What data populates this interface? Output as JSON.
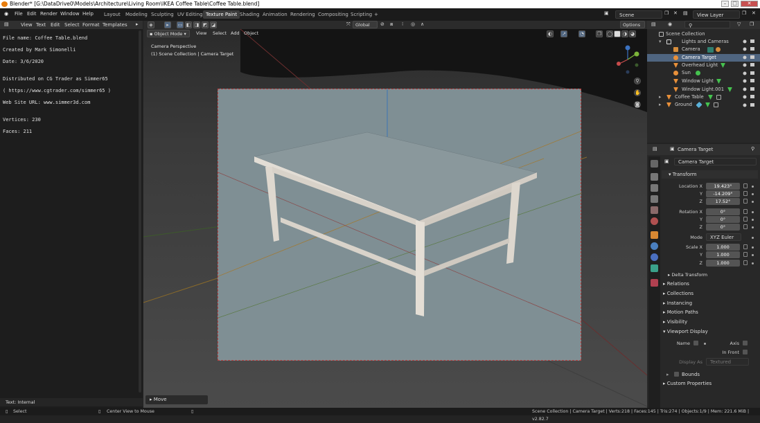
{
  "window": {
    "title": "Blender* [G:\\DataDrive0\\Models\\Architecture\\Living Room\\IKEA Coffee Table\\Coffee Table.blend]"
  },
  "menu": [
    "File",
    "Edit",
    "Render",
    "Window",
    "Help"
  ],
  "workspaces": [
    {
      "label": "Layout"
    },
    {
      "label": "Modeling"
    },
    {
      "label": "Sculpting"
    },
    {
      "label": "UV Editing"
    },
    {
      "label": "Texture Paint"
    },
    {
      "label": "Shading"
    },
    {
      "label": "Animation"
    },
    {
      "label": "Rendering"
    },
    {
      "label": "Compositing"
    },
    {
      "label": "Scripting"
    },
    {
      "label": "+"
    }
  ],
  "active_workspace": "Texture Paint",
  "scene": {
    "name": "Scene",
    "view_layer": "View Layer"
  },
  "text_editor": {
    "menu": [
      "View",
      "Text",
      "Edit",
      "Select",
      "Format",
      "Templates"
    ],
    "lines": [
      "File name: Coffee Table.blend",
      "Created by Mark Simonelli",
      "Date: 3/6/2020",
      "",
      "Distributed on CG Trader as Simmer65",
      "( https://www.cgtrader.com/simmer65 )",
      "Web Site URL: www.simmer3d.com",
      "",
      "Vertices: 230",
      "Faces: 211"
    ],
    "footer": "Text: Internal"
  },
  "viewport": {
    "mode": "Object Mode",
    "menu": [
      "View",
      "Select",
      "Add",
      "Object"
    ],
    "orientation": "Global",
    "options": "Options",
    "perspective_label": "Camera Perspective",
    "collection_label": "(1) Scene Collection | Camera Target",
    "last_op": "Move"
  },
  "outliner": {
    "root": "Scene Collection",
    "rows": [
      {
        "label": "Lights and Cameras"
      },
      {
        "label": "Camera"
      },
      {
        "label": "Camera Target"
      },
      {
        "label": "Overhead Light"
      },
      {
        "label": "Sun"
      },
      {
        "label": "Window Light"
      },
      {
        "label": "Window Light.001"
      },
      {
        "label": "Coffee Table"
      },
      {
        "label": "Ground"
      }
    ],
    "selected": "Camera Target"
  },
  "properties": {
    "object_name": "Camera Target",
    "datablock": "Camera Target",
    "transform_title": "Transform",
    "location": {
      "label": "Location X",
      "x": "19.423°",
      "y": "-14.209°",
      "z": "17.52°"
    },
    "rotation": {
      "label": "Rotation X",
      "x": "0°",
      "y": "0°",
      "z": "0°"
    },
    "mode_label": "Mode",
    "mode_value": "XYZ Euler",
    "scale": {
      "label": "Scale X",
      "x": "1.000",
      "y": "1.000",
      "z": "1.000"
    },
    "axis_y": "Y",
    "axis_z": "Z",
    "delta": "Delta Transform",
    "sections": [
      "Relations",
      "Collections",
      "Instancing",
      "Motion Paths",
      "Visibility"
    ],
    "viewport_display": "Viewport Display",
    "vd_name": "Name",
    "vd_axis": "Axis",
    "vd_infront": "In Front",
    "vd_displayas": "Display As",
    "vd_displayas_val": "Textured",
    "vd_bounds": "Bounds",
    "custom_props": "Custom Properties"
  },
  "status": {
    "left": "Select",
    "middle": "Center View to Mouse",
    "right": "Scene Collection | Camera Target | Verts:218 | Faces:145 | Tris:274 | Objects:1/9 | Mem: 221.6 MiB | v2.82.7"
  },
  "colors": {
    "accent": "#4f6580",
    "frame_border": "#b44444",
    "camera_fill": "#7f8f94"
  }
}
